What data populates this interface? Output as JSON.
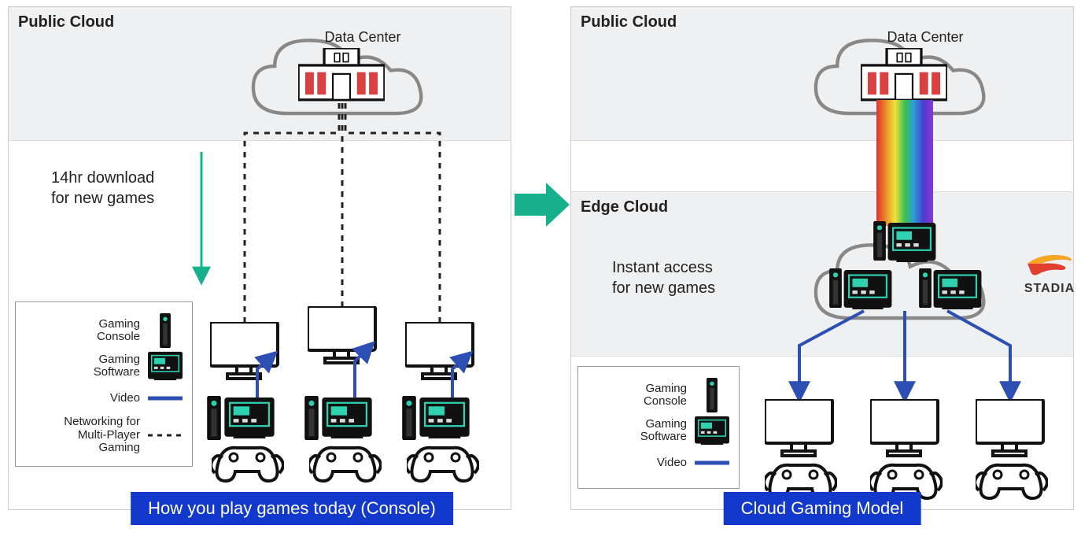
{
  "left": {
    "public_cloud": "Public Cloud",
    "data_center": "Data Center",
    "download_line1": "14hr download",
    "download_line2": "for new games",
    "caption": "How you play games today (Console)"
  },
  "right": {
    "public_cloud": "Public Cloud",
    "data_center": "Data Center",
    "edge_cloud": "Edge Cloud",
    "instant_line1": "Instant access",
    "instant_line2": "for new games",
    "caption": "Cloud Gaming Model",
    "stadia": "STADIA"
  },
  "legend": {
    "console": "Gaming Console",
    "software": "Gaming Software",
    "video": "Video",
    "networking": "Networking for Multi-Player Gaming"
  },
  "colors": {
    "blue": "#2d4fb3",
    "teal": "#16b08d",
    "caption_bg": "#1238cc",
    "band": "#eef0f1"
  }
}
